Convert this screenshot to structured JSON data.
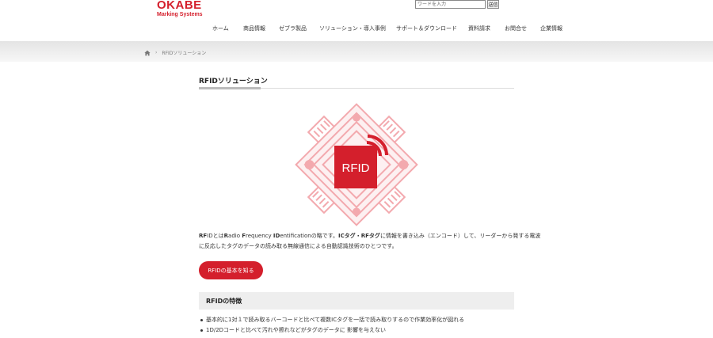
{
  "header": {
    "logo_main": "OKABE",
    "logo_sub": "Marking Systems",
    "search_placeholder": "ワードを入力",
    "search_button": "送信",
    "nav": [
      "ホーム",
      "商品情報",
      "ゼブラ製品",
      "ソリューション・導入事例",
      "サポート＆ダウンロード",
      "資料請求",
      "お問合せ",
      "企業情報"
    ]
  },
  "breadcrumb": {
    "home_icon": "home-icon",
    "separator": "›",
    "current": "RFIDソリューション"
  },
  "main": {
    "title": "RFIDソリューション",
    "image": {
      "label": "RFID",
      "colors": {
        "primary": "#d41f2c",
        "light": "#f3a9ae"
      }
    },
    "para_line1": {
      "t1": "RF",
      "t2": "IDとは",
      "t3": "R",
      "t4": "adio ",
      "t5": "F",
      "t6": "requency ",
      "t7": "ID",
      "t8": "entificationの略です。",
      "t9": "ICタグ・RFタグ",
      "t10": "に情報を書き込み（エンコード）して、リーダーから発する電波"
    },
    "para_line2": "に反応したタグのデータの読み取る無線通信による自動認識技術のひとつです。",
    "cta_label": "RFIDの基本を知る",
    "features_title": "RFIDの特徴",
    "features": [
      "基本的に1対１で読み取るバーコードと比べて複数ICタグを一括で読み取りするので作業効率化が図れる",
      "1D/2Dコードと比べて汚れや擦れなどがタグのデータに 影響を与えない"
    ]
  },
  "colors": {
    "brand": "#d41f2c",
    "band": "#eeeeee"
  }
}
